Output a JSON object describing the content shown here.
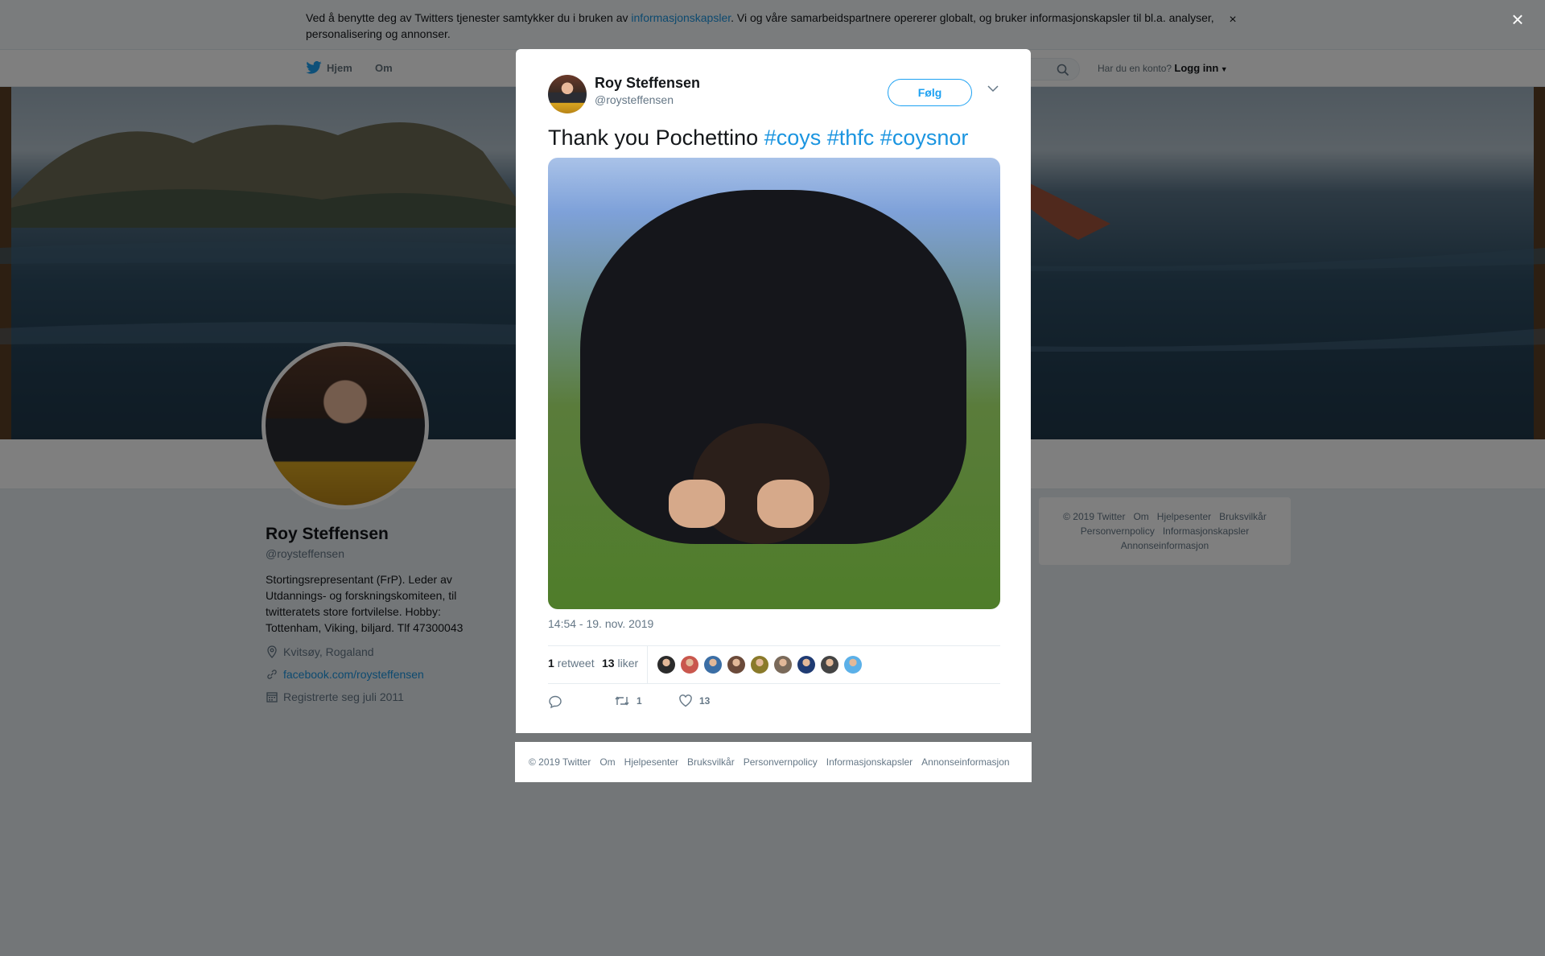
{
  "cookie": {
    "text_before": "Ved å benytte deg av Twitters tjenester samtykker du i bruken av ",
    "link": "informasjonskapsler",
    "text_after": ". Vi og våre samarbeidspartnere opererer globalt, og bruker informasjonskapsler til bl.a. analyser, personalisering og annonser.",
    "close": "×"
  },
  "nav": {
    "home": "Hjem",
    "about": "Om",
    "account_prompt": "Har du en konto?",
    "login": "Logg inn"
  },
  "profile": {
    "name": "Roy Steffensen",
    "handle": "@roysteffensen",
    "bio": "Stortingsrepresentant (FrP). Leder av Utdannings- og forskningskomiteen, til twitteratets store fortvilelse. Hobby: Tottenham, Viking, biljard. Tlf 47300043",
    "location": "Kvitsøy, Rogaland",
    "website": "facebook.com/roysteffensen",
    "joined": "Registrerte seg juli 2011"
  },
  "side_footer": {
    "items": [
      "© 2019 Twitter",
      "Om",
      "Hjelpesenter",
      "Bruksvilkår",
      "Personvernpolicy",
      "Informasjonskapsler",
      "Annonseinformasjon"
    ]
  },
  "overlay_close": "×",
  "tweet": {
    "author_name": "Roy Steffensen",
    "author_handle": "@roysteffensen",
    "follow": "Følg",
    "text": "Thank you Pochettino ",
    "hashtags": [
      "#coys",
      "#thfc",
      "#coysnor"
    ],
    "timestamp": "14:54 - 19. nov. 2019",
    "retweets_count": "1",
    "retweets_label": "retweet",
    "likes_count": "13",
    "likes_label": "liker",
    "action_retweet_count": "1",
    "action_like_count": "13"
  },
  "likers_colors": [
    "#2b2b2b",
    "#c9574d",
    "#3b6ea5",
    "#6b4a3a",
    "#8a7a2a",
    "#7a6a5a",
    "#1f3b73",
    "#444444",
    "#5bb0e8"
  ],
  "modal_footer": {
    "items": [
      "© 2019 Twitter",
      "Om",
      "Hjelpesenter",
      "Bruksvilkår",
      "Personvernpolicy",
      "Informasjonskapsler",
      "Annonseinformasjon"
    ]
  },
  "colors": {
    "accent": "#1da1f2",
    "link": "#1b95e0",
    "muted": "#657786"
  }
}
